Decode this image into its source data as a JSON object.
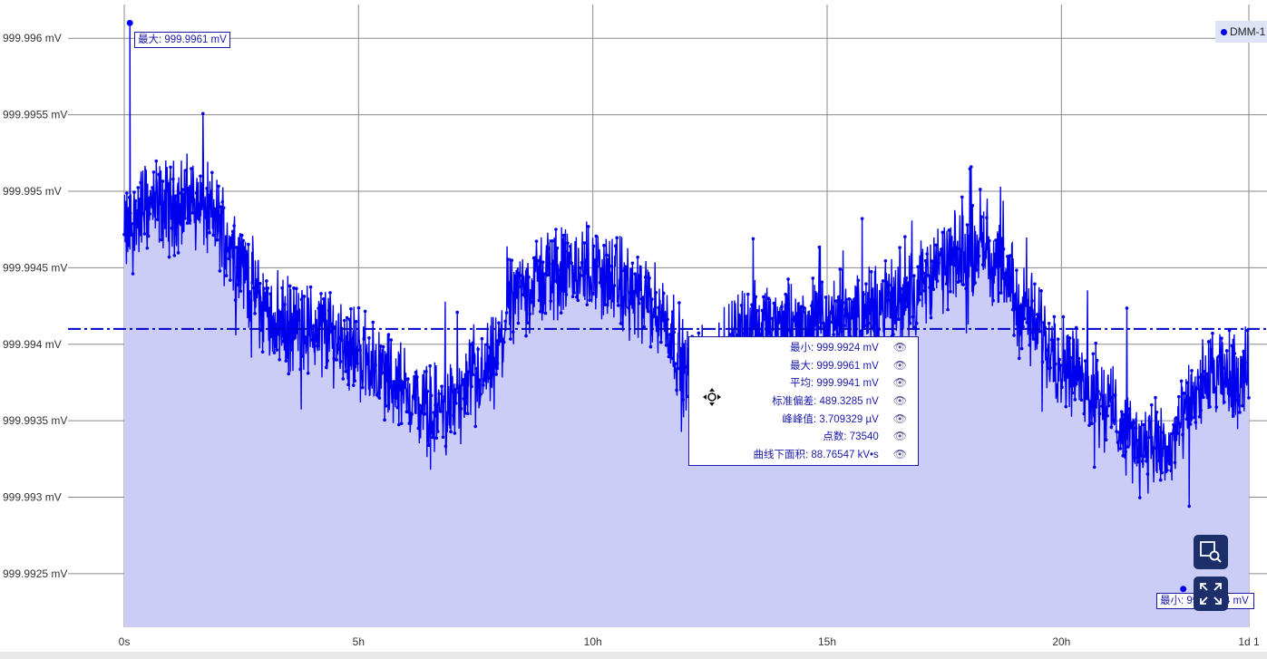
{
  "chart_data": {
    "type": "line",
    "series": [
      {
        "name": "DMM-1",
        "color": "#0000ee",
        "fill": "#cccdf7"
      }
    ],
    "x_unit": "hours",
    "xlim": [
      0,
      24
    ],
    "x_ticks": [
      {
        "value": 0,
        "label": "0s"
      },
      {
        "value": 5,
        "label": "5h"
      },
      {
        "value": 10,
        "label": "10h"
      },
      {
        "value": 15,
        "label": "15h"
      },
      {
        "value": 20,
        "label": "20h"
      },
      {
        "value": 24,
        "label": "1d 1"
      }
    ],
    "ylim": [
      999.99215,
      999.99625
    ],
    "y_ticks": [
      {
        "value": 999.996,
        "label": "999.996 mV"
      },
      {
        "value": 999.9955,
        "label": "999.9955 mV"
      },
      {
        "value": 999.995,
        "label": "999.995 mV"
      },
      {
        "value": 999.9945,
        "label": "999.9945 mV"
      },
      {
        "value": 999.994,
        "label": "999.994 mV"
      },
      {
        "value": 999.9935,
        "label": "999.9935 mV"
      },
      {
        "value": 999.993,
        "label": "999.993 mV"
      },
      {
        "value": 999.9925,
        "label": "999.9925 mV"
      }
    ],
    "trend": [
      [
        0.0,
        999.9947
      ],
      [
        0.4,
        999.9949
      ],
      [
        1.0,
        999.9949
      ],
      [
        1.5,
        999.99495
      ],
      [
        2.0,
        999.9948
      ],
      [
        2.4,
        999.9946
      ],
      [
        3.0,
        999.9942
      ],
      [
        3.6,
        999.9941
      ],
      [
        4.3,
        999.9941
      ],
      [
        5.0,
        999.99395
      ],
      [
        5.8,
        999.99375
      ],
      [
        6.5,
        999.99355
      ],
      [
        7.2,
        999.99365
      ],
      [
        8.0,
        999.9939
      ],
      [
        8.2,
        999.9943
      ],
      [
        9.0,
        999.99445
      ],
      [
        10.0,
        999.9945
      ],
      [
        11.0,
        999.9943
      ],
      [
        11.6,
        999.99415
      ],
      [
        12.0,
        999.9938
      ],
      [
        12.8,
        999.9938
      ],
      [
        13.0,
        999.9941
      ],
      [
        14.0,
        999.9941
      ],
      [
        15.0,
        999.99415
      ],
      [
        16.0,
        999.9942
      ],
      [
        17.0,
        999.9944
      ],
      [
        18.0,
        999.9946
      ],
      [
        18.3,
        999.9947
      ],
      [
        19.0,
        999.9943
      ],
      [
        20.0,
        999.9939
      ],
      [
        21.0,
        999.9936
      ],
      [
        21.6,
        999.99335
      ],
      [
        22.3,
        999.9933
      ],
      [
        23.0,
        999.99375
      ],
      [
        24.0,
        999.9938
      ]
    ],
    "noise_amplitude": 0.00045,
    "mean": 999.9941,
    "max_point": {
      "x": 0.12,
      "y": 999.9961,
      "label": "最大: 999.9961 mV"
    },
    "min_point": {
      "x": 22.6,
      "y": 999.9924,
      "label": "最小: 999.9924 mV"
    },
    "legend_position": "top-right",
    "grid": true
  },
  "legend": {
    "label": "DMM-1"
  },
  "stats": [
    {
      "label": "最小: 999.9924 mV"
    },
    {
      "label": "最大: 999.9961 mV"
    },
    {
      "label": "平均: 999.9941 mV"
    },
    {
      "label": "标准偏差: 489.3285 nV"
    },
    {
      "label": "峰峰值: 3.709329 µV"
    },
    {
      "label": "点数: 73540"
    },
    {
      "label": "曲线下面积: 88.76547 kV•s"
    }
  ],
  "icons": {
    "stats_move": "move-icon",
    "eye": "eye-icon",
    "zoom": "zoom-box-icon",
    "fullscreen": "expand-icon"
  }
}
